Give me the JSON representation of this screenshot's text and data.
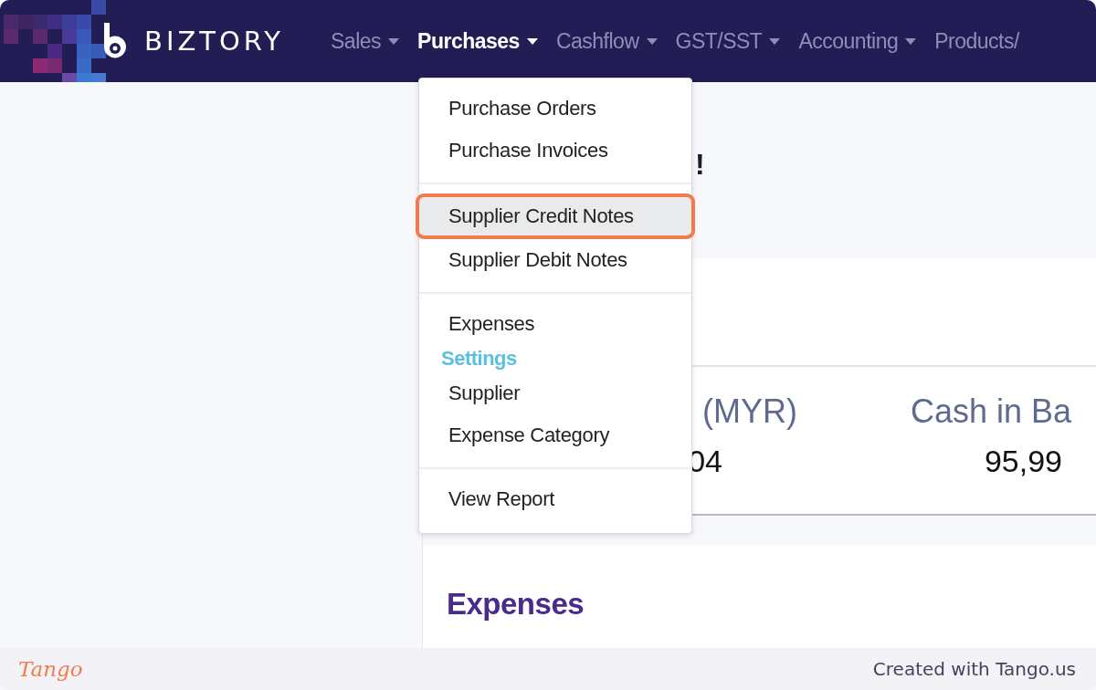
{
  "brand": {
    "name": "BIZTORY"
  },
  "nav": [
    {
      "label": "Sales",
      "selected": false,
      "caret": true
    },
    {
      "label": "Purchases",
      "selected": true,
      "caret": true
    },
    {
      "label": "Cashflow",
      "selected": false,
      "caret": true
    },
    {
      "label": "GST/SST",
      "selected": false,
      "caret": true
    },
    {
      "label": "Accounting",
      "selected": false,
      "caret": true
    },
    {
      "label": "Products/",
      "selected": false,
      "caret": false
    }
  ],
  "dropdown": [
    {
      "kind": "item",
      "label": "Purchase Orders",
      "selected": false
    },
    {
      "kind": "item",
      "label": "Purchase Invoices",
      "selected": false
    },
    {
      "kind": "divider"
    },
    {
      "kind": "item",
      "label": "Supplier Credit Notes",
      "selected": true
    },
    {
      "kind": "item",
      "label": "Supplier Debit Notes",
      "selected": false
    },
    {
      "kind": "divider"
    },
    {
      "kind": "item",
      "label": "Expenses",
      "selected": false
    },
    {
      "kind": "header",
      "label": "Settings"
    },
    {
      "kind": "item",
      "label": "Supplier",
      "selected": false
    },
    {
      "kind": "item",
      "label": "Expense Category",
      "selected": false
    },
    {
      "kind": "divider"
    },
    {
      "kind": "item",
      "label": "View Report",
      "selected": false
    }
  ],
  "greeting": {
    "text": "!"
  },
  "stats": [
    {
      "label": "(MYR)",
      "value": "04"
    },
    {
      "label": "Cash in Ba",
      "value": "95,99"
    }
  ],
  "expenses_card": {
    "title": "Expenses"
  },
  "footer": {
    "logo": "Tango",
    "credit": "Created with Tango.us"
  }
}
